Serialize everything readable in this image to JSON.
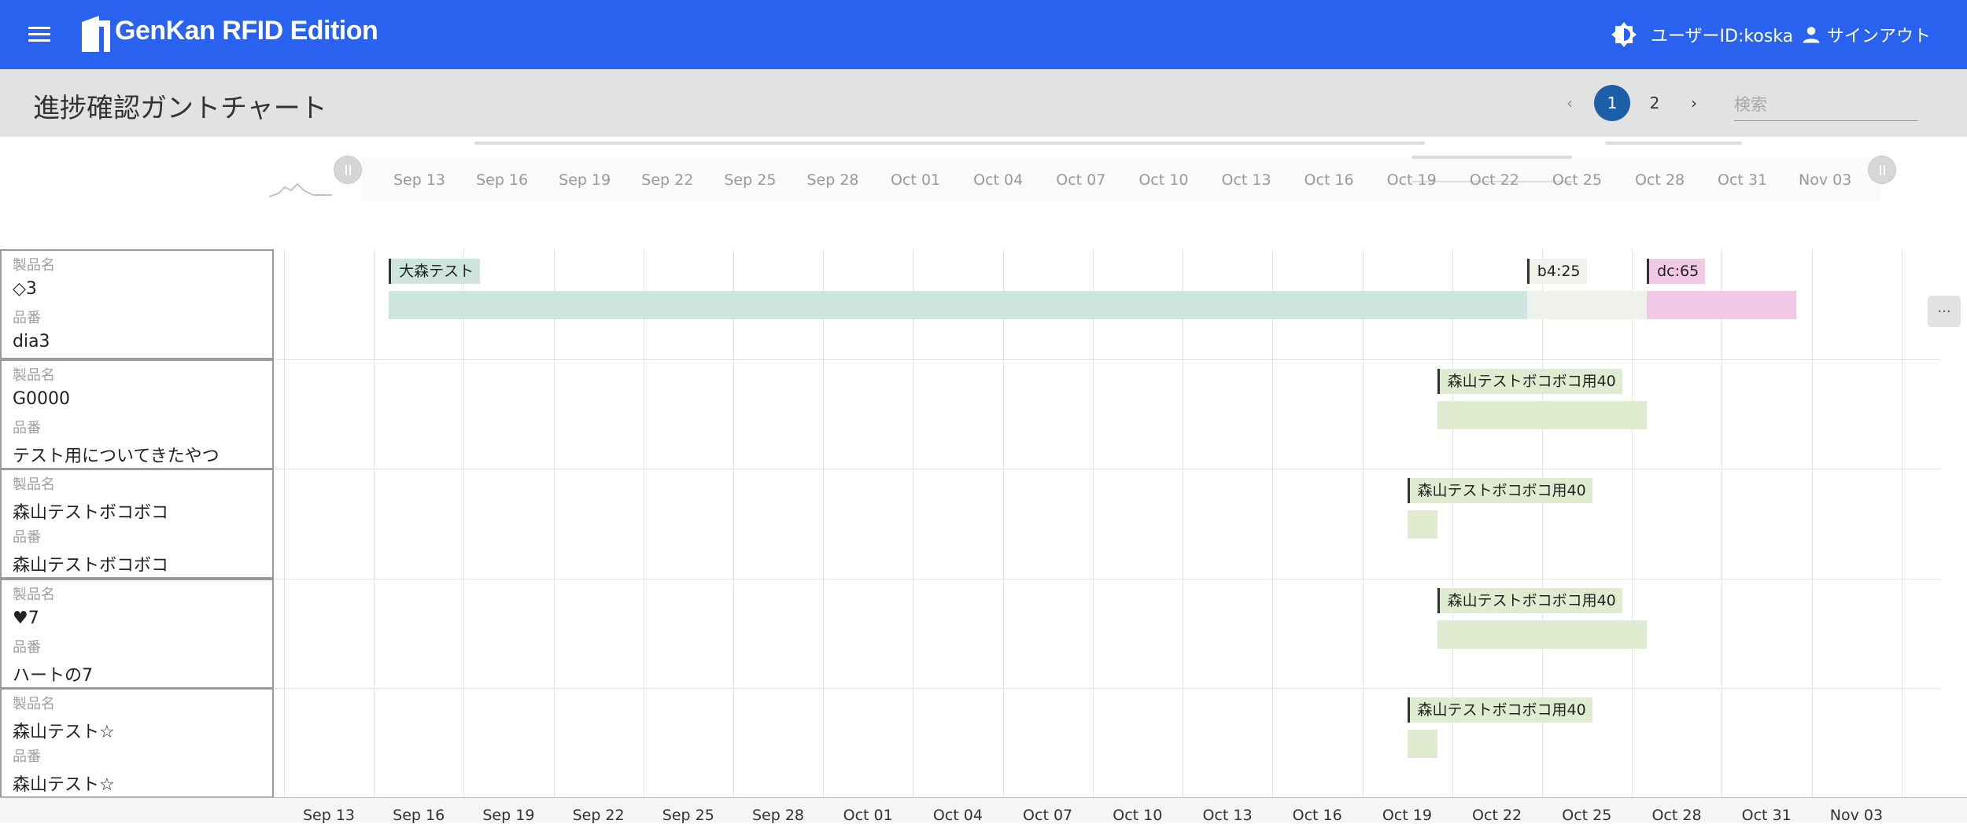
{
  "app": {
    "title": "GenKan RFID Edition",
    "user_id": "ユーザーID:koska",
    "signout_label": "サインアウト",
    "accent": "#2962ee"
  },
  "page": {
    "title": "進捗確認ガントチャート"
  },
  "pagination": {
    "prev": "‹",
    "pages": [
      "1",
      "2"
    ],
    "current": "1",
    "next": "›"
  },
  "search": {
    "placeholder": "検索",
    "value": ""
  },
  "overview_ticks": [
    "Sep 13",
    "Sep 16",
    "Sep 19",
    "Sep 22",
    "Sep 25",
    "Sep 28",
    "Oct 01",
    "Oct 04",
    "Oct 07",
    "Oct 10",
    "Oct 13",
    "Oct 16",
    "Oct 19",
    "Oct 22",
    "Oct 25",
    "Oct 28",
    "Oct 31",
    "Nov 03"
  ],
  "bottom_ticks": [
    "Sep 13",
    "Sep 16",
    "Sep 19",
    "Sep 22",
    "Sep 25",
    "Sep 28",
    "Oct 01",
    "Oct 04",
    "Oct 07",
    "Oct 10",
    "Oct 13",
    "Oct 16",
    "Oct 19",
    "Oct 22",
    "Oct 25",
    "Oct 28",
    "Oct 31",
    "Nov 03"
  ],
  "label_captions": {
    "product_name": "製品名",
    "product_number": "品番"
  },
  "more_label": "···",
  "rows": [
    {
      "product_name": "◇3",
      "product_number": "dia3"
    },
    {
      "product_name": "G0000",
      "product_number": "テスト用についてきたやつ"
    },
    {
      "product_name": "森山テストボコボコ",
      "product_number": "森山テストボコボコ"
    },
    {
      "product_name": "♥7",
      "product_number": "ハートの7"
    },
    {
      "product_name": "森山テスト☆",
      "product_number": "森山テスト☆"
    }
  ],
  "tasks": [
    {
      "row": 0,
      "label": "大森テスト",
      "start": "Sep 15",
      "end": "Oct 23",
      "color": "#cde5de"
    },
    {
      "row": 0,
      "label": "b4:25",
      "start": "Oct 23",
      "end": "Oct 27",
      "color": "#eef2ea"
    },
    {
      "row": 0,
      "label": "dc:65",
      "start": "Oct 27",
      "end": "Nov 01",
      "color": "#f1c9e6"
    },
    {
      "row": 1,
      "label": "森山テストボコボコ用40",
      "start": "Oct 20",
      "end": "Oct 27",
      "color": "#e0ecd0"
    },
    {
      "row": 2,
      "label": "森山テストボコボコ用40",
      "start": "Oct 19",
      "end": "Oct 20",
      "color": "#e0ecd0"
    },
    {
      "row": 3,
      "label": "森山テストボコボコ用40",
      "start": "Oct 20",
      "end": "Oct 27",
      "color": "#e0ecd0"
    },
    {
      "row": 4,
      "label": "森山テストボコボコ用40",
      "start": "Oct 19",
      "end": "Oct 20",
      "color": "#e0ecd0"
    }
  ]
}
